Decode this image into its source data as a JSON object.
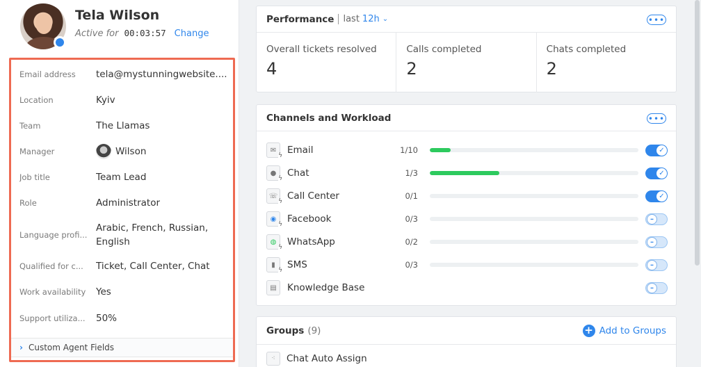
{
  "agent": {
    "name": "Tela Wilson",
    "active_label": "Active for",
    "active_time": "00:03:57",
    "change_label": "Change"
  },
  "info": {
    "email_label": "Email address",
    "email_value": "tela@mystunningwebsite....",
    "location_label": "Location",
    "location_value": "Kyiv",
    "team_label": "Team",
    "team_value": "The Llamas",
    "manager_label": "Manager",
    "manager_value": "Wilson",
    "job_label": "Job title",
    "job_value": "Team Lead",
    "role_label": "Role",
    "role_value": "Administrator",
    "language_label": "Language profi...",
    "language_value": "Arabic, French, Russian, English",
    "qualified_label": "Qualified for c...",
    "qualified_value": "Ticket, Call Center, Chat",
    "work_label": "Work availability",
    "work_value": "Yes",
    "support_label": "Support utiliza...",
    "support_value": "50%",
    "custom_fields_label": "Custom Agent Fields"
  },
  "performance": {
    "title": "Performance",
    "filter_prefix": "last",
    "filter_value": "12h",
    "more_label": "•••",
    "stats": [
      {
        "label": "Overall tickets resolved",
        "value": "4"
      },
      {
        "label": "Calls completed",
        "value": "2"
      },
      {
        "label": "Chats completed",
        "value": "2"
      }
    ]
  },
  "channels": {
    "title": "Channels and Workload",
    "more_label": "•••",
    "items": [
      {
        "name": "Email",
        "count": "1/10",
        "fill": 0.1,
        "enabled": true,
        "icon": "email-icon"
      },
      {
        "name": "Chat",
        "count": "1/3",
        "fill": 0.333,
        "enabled": true,
        "icon": "chat-icon"
      },
      {
        "name": "Call Center",
        "count": "0/1",
        "fill": 0,
        "enabled": true,
        "icon": "phone-icon"
      },
      {
        "name": "Facebook",
        "count": "0/3",
        "fill": 0,
        "enabled": false,
        "icon": "messenger-icon"
      },
      {
        "name": "WhatsApp",
        "count": "0/2",
        "fill": 0,
        "enabled": false,
        "icon": "whatsapp-icon"
      },
      {
        "name": "SMS",
        "count": "0/3",
        "fill": 0,
        "enabled": false,
        "icon": "sms-icon"
      },
      {
        "name": "Knowledge Base",
        "count": "",
        "fill": null,
        "enabled": false,
        "icon": "knowledge-base-icon"
      }
    ]
  },
  "groups": {
    "title": "Groups",
    "count": "(9)",
    "add_label": "Add to Groups",
    "items": [
      {
        "name": "Chat Auto Assign"
      }
    ]
  },
  "colors": {
    "accent": "#2f86eb",
    "highlight_border": "#ee6a52",
    "progress": "#2dca5e"
  }
}
